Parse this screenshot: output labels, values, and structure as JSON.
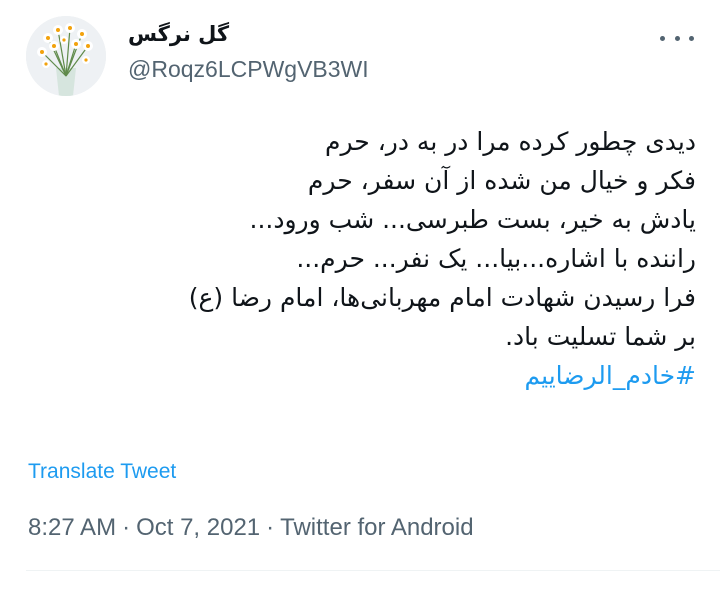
{
  "tweet": {
    "author": {
      "display_name": "گل نرگس",
      "handle": "@Roqz6LCPWgVB3WI"
    },
    "body_lines": [
      "دیدی چطور کرده مرا در به در، حرم",
      "فکر و خیال من شده از آن سفر، حرم",
      "یادش به خیر، بست طبرسی... شب ورود...",
      "راننده با اشاره...بیا... یک نفر... حرم...",
      "فرا رسیدن شهادت امام مهربانی‌ها، امام رضا (ع)",
      "بر شما تسلیت باد."
    ],
    "hashtag": "#خادم_الرضاییم",
    "translate_label": "Translate Tweet",
    "time": "8:27 AM",
    "date": "Oct 7, 2021",
    "source": "Twitter for Android",
    "separator": "·"
  },
  "icons": {
    "more": "more-dots-icon",
    "avatar": "daffodil-bouquet-avatar"
  },
  "colors": {
    "link": "#1d9bf0",
    "secondary_text": "#536471",
    "primary_text": "#0f1419"
  }
}
